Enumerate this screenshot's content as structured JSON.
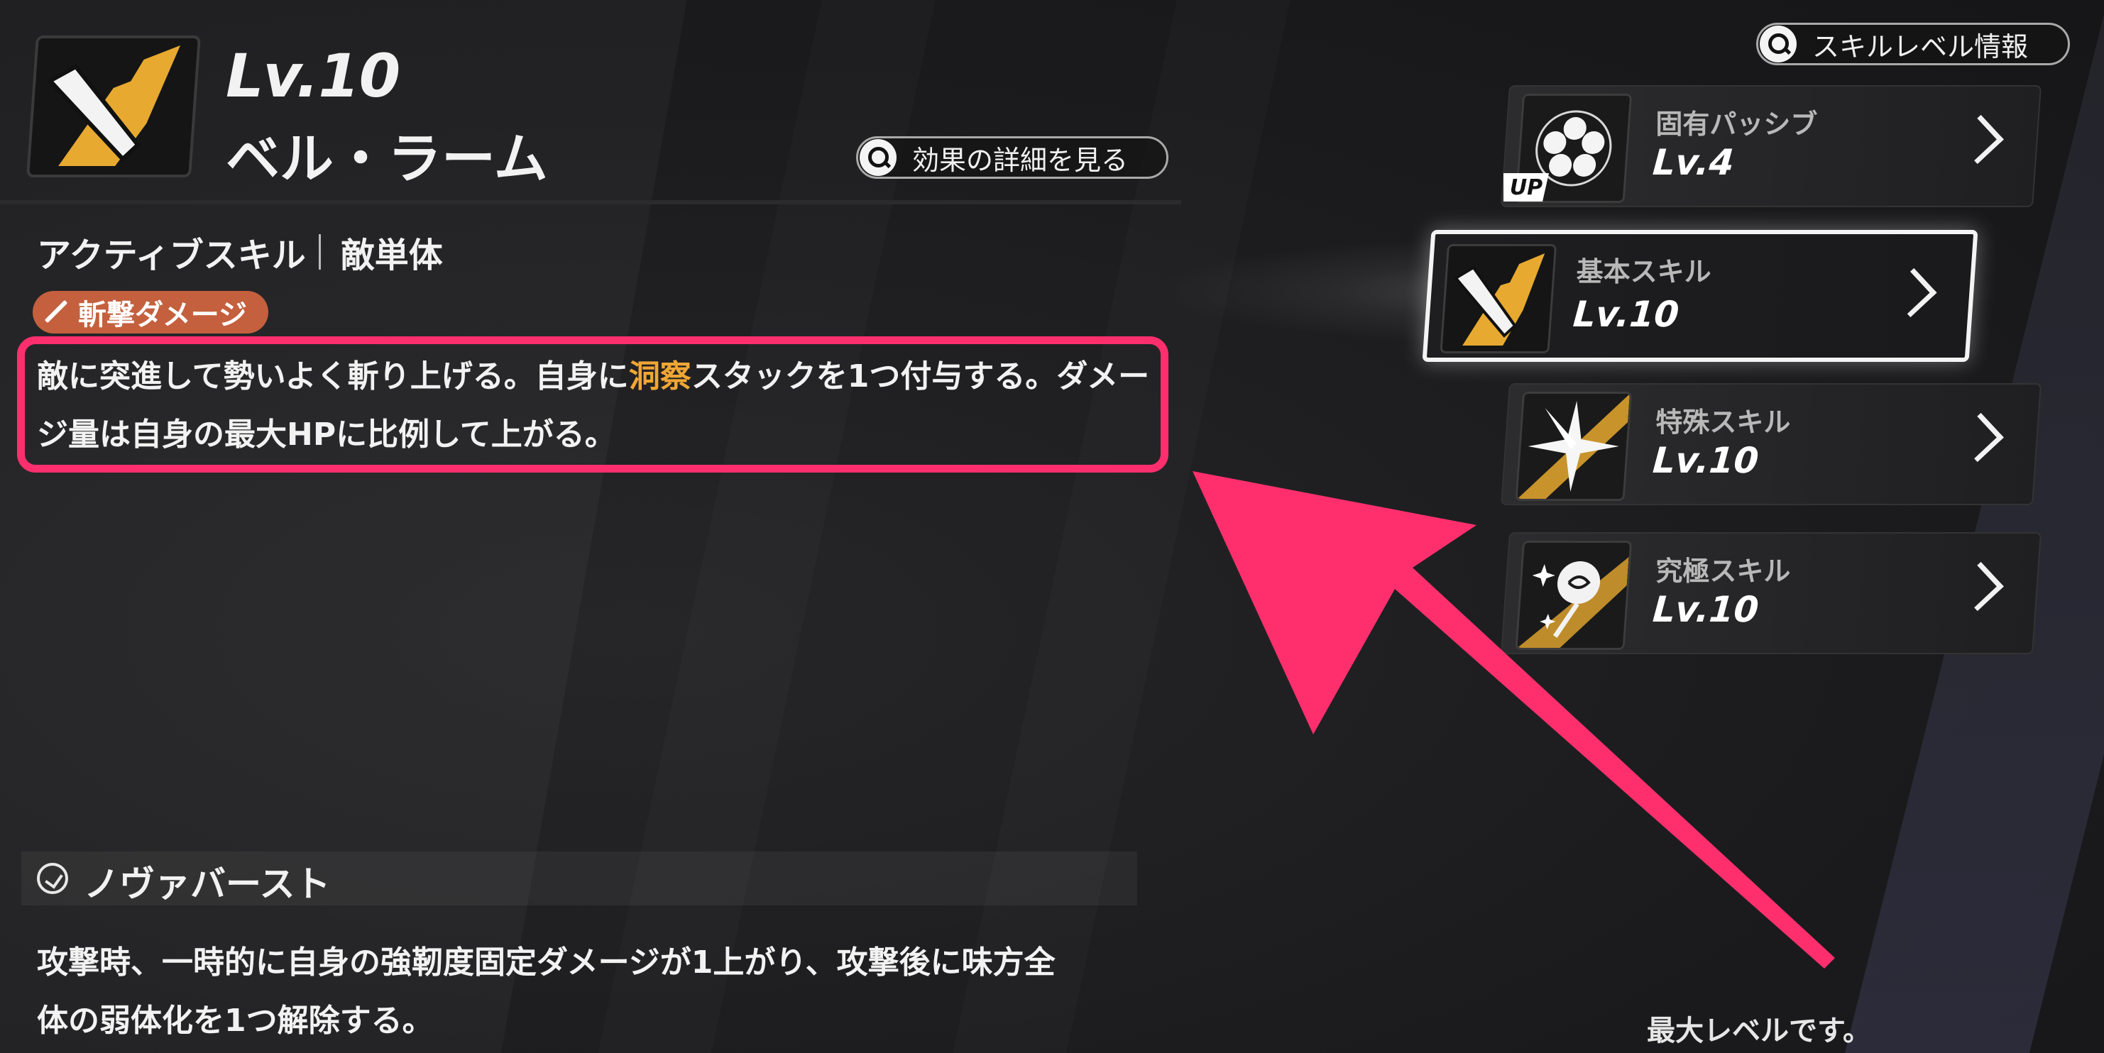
{
  "skill": {
    "level": "Lv.10",
    "name": "ベル・ラーム",
    "detail_button": "効果の詳細を見る",
    "type": "アクティブスキル",
    "target": "敵単体",
    "damage_tag": "斬撃ダメージ",
    "desc_before": "敵に突進して勢いよく斬り上げる。自身に",
    "desc_highlight": "洞察",
    "desc_after": "スタックを1つ付与する。ダメージ量は自身の最大HPに比例して上がる。",
    "highlight_color": "#f0a634"
  },
  "nova": {
    "title": "ノヴァバースト",
    "desc": "攻撃時、一時的に自身の強靭度固定ダメージが1上がり、攻撃後に味方全体の弱体化を1つ解除する。"
  },
  "sidebar": {
    "level_info_button": "スキルレベル情報",
    "cards": [
      {
        "title": "固有パッシブ",
        "level": "Lv.4",
        "icon": "flower-icon",
        "badge": "UP"
      },
      {
        "title": "基本スキル",
        "level": "Lv.10",
        "icon": "slash-icon"
      },
      {
        "title": "特殊スキル",
        "level": "Lv.10",
        "icon": "star-burst-icon"
      },
      {
        "title": "究極スキル",
        "level": "Lv.10",
        "icon": "rose-icon"
      }
    ],
    "max_level_text": "最大レベルです。"
  },
  "colors": {
    "accent": "#ff2f6e",
    "gold": "#e7a92f",
    "tag": "#c4603e"
  }
}
